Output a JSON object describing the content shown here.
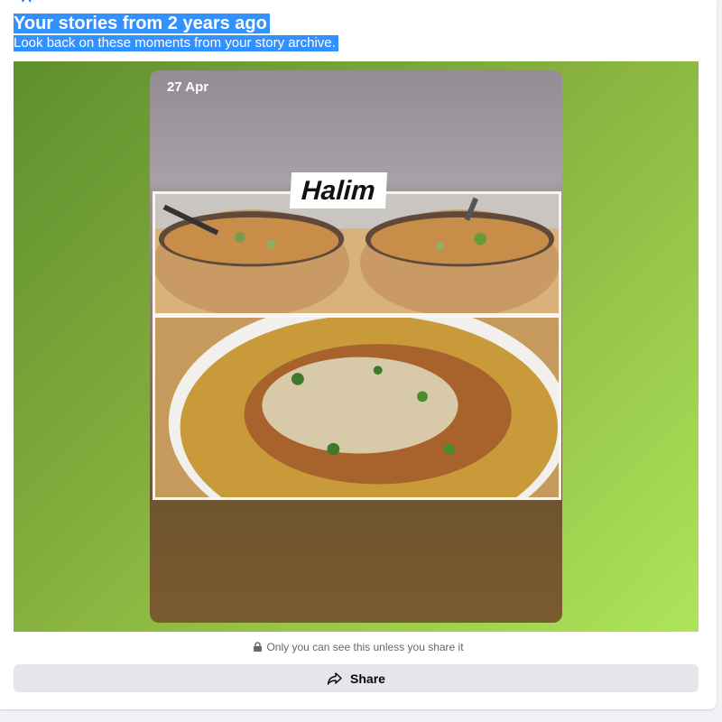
{
  "memory": {
    "title": "Your stories from 2 years ago",
    "subtitle": "Look back on these moments from your story archive."
  },
  "story": {
    "date": "27 Apr",
    "label": "Halim",
    "background_top": "#938c93",
    "background_bottom": "#7a5b2e",
    "outer_gradient": [
      "#5f8e2e",
      "#aee45b"
    ]
  },
  "privacy": {
    "icon": "lock-icon",
    "text": "Only you can see this unless you share it"
  },
  "share": {
    "icon": "share-icon",
    "label": "Share"
  }
}
